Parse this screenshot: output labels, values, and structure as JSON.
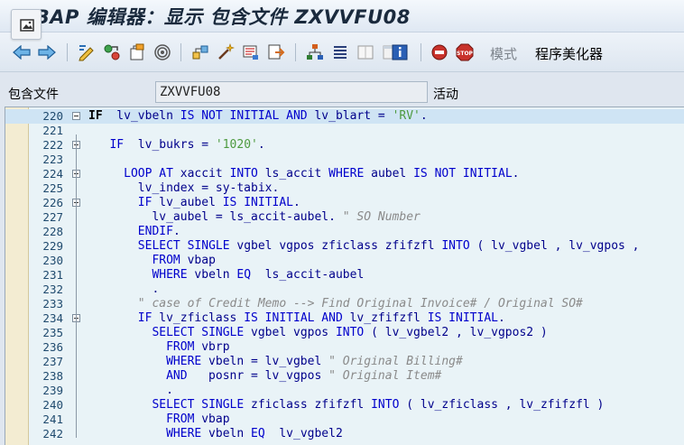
{
  "window": {
    "title": "ABAP 编辑器：显示 包含文件 ZXVVFU08"
  },
  "toolbar": {
    "mode_label": "模式",
    "pretty_printer_label": "程序美化器"
  },
  "include_field": {
    "label": "包含文件",
    "value": "ZXVVFU08",
    "status": "活动"
  },
  "editor": {
    "lines": [
      {
        "no": "220",
        "tokens": [
          [
            "b",
            "IF"
          ],
          [
            "",
            "  lv_vbeln "
          ],
          [
            "k",
            "IS NOT INITIAL AND"
          ],
          [
            "",
            " lv_blart = "
          ],
          [
            "s",
            "'RV'"
          ],
          [
            "",
            "."
          ]
        ]
      },
      {
        "no": "221",
        "tokens": []
      },
      {
        "no": "222",
        "tokens": [
          [
            "",
            "   "
          ],
          [
            "k",
            "IF"
          ],
          [
            "",
            "  lv_bukrs = "
          ],
          [
            "s",
            "'1020'"
          ],
          [
            "",
            "."
          ]
        ]
      },
      {
        "no": "223",
        "tokens": []
      },
      {
        "no": "224",
        "tokens": [
          [
            "",
            "     "
          ],
          [
            "k",
            "LOOP AT"
          ],
          [
            "",
            " xaccit "
          ],
          [
            "k",
            "INTO"
          ],
          [
            "",
            " ls_accit "
          ],
          [
            "k",
            "WHERE"
          ],
          [
            "",
            " aubel "
          ],
          [
            "k",
            "IS NOT INITIAL"
          ],
          [
            "",
            "."
          ]
        ]
      },
      {
        "no": "225",
        "tokens": [
          [
            "",
            "       lv_index = sy-tabix."
          ]
        ]
      },
      {
        "no": "226",
        "tokens": [
          [
            "",
            "       "
          ],
          [
            "k",
            "IF"
          ],
          [
            "",
            " lv_aubel "
          ],
          [
            "k",
            "IS INITIAL"
          ],
          [
            "",
            "."
          ]
        ]
      },
      {
        "no": "227",
        "tokens": [
          [
            "",
            "         lv_aubel = ls_accit-aubel. "
          ],
          [
            "c",
            "\" SO Number"
          ]
        ]
      },
      {
        "no": "228",
        "tokens": [
          [
            "",
            "       "
          ],
          [
            "k",
            "ENDIF"
          ],
          [
            "",
            "."
          ]
        ]
      },
      {
        "no": "229",
        "tokens": [
          [
            "",
            "       "
          ],
          [
            "k",
            "SELECT SINGLE"
          ],
          [
            "",
            " vgbel vgpos zficlass zfifzfl "
          ],
          [
            "k",
            "INTO"
          ],
          [
            "",
            " ( lv_vgbel , lv_vgpos ,"
          ]
        ]
      },
      {
        "no": "230",
        "tokens": [
          [
            "",
            "         "
          ],
          [
            "k",
            "FROM"
          ],
          [
            "",
            " vbap"
          ]
        ]
      },
      {
        "no": "231",
        "tokens": [
          [
            "",
            "         "
          ],
          [
            "k",
            "WHERE"
          ],
          [
            "",
            " vbeln "
          ],
          [
            "k",
            "EQ"
          ],
          [
            "",
            "  ls_accit-aubel"
          ]
        ]
      },
      {
        "no": "232",
        "tokens": [
          [
            "",
            "         ."
          ]
        ]
      },
      {
        "no": "233",
        "tokens": [
          [
            "",
            "       "
          ],
          [
            "c",
            "\" case of Credit Memo --> Find Original Invoice# / Original SO#"
          ]
        ]
      },
      {
        "no": "234",
        "tokens": [
          [
            "",
            "       "
          ],
          [
            "k",
            "IF"
          ],
          [
            "",
            " lv_zficlass "
          ],
          [
            "k",
            "IS INITIAL AND"
          ],
          [
            "",
            " lv_zfifzfl "
          ],
          [
            "k",
            "IS INITIAL"
          ],
          [
            "",
            "."
          ]
        ]
      },
      {
        "no": "235",
        "tokens": [
          [
            "",
            "         "
          ],
          [
            "k",
            "SELECT SINGLE"
          ],
          [
            "",
            " vgbel vgpos "
          ],
          [
            "k",
            "INTO"
          ],
          [
            "",
            " ( lv_vgbel2 , lv_vgpos2 )"
          ]
        ]
      },
      {
        "no": "236",
        "tokens": [
          [
            "",
            "           "
          ],
          [
            "k",
            "FROM"
          ],
          [
            "",
            " vbrp"
          ]
        ]
      },
      {
        "no": "237",
        "tokens": [
          [
            "",
            "           "
          ],
          [
            "k",
            "WHERE"
          ],
          [
            "",
            " vbeln = lv_vgbel "
          ],
          [
            "c",
            "\" Original Billing#"
          ]
        ]
      },
      {
        "no": "238",
        "tokens": [
          [
            "",
            "           "
          ],
          [
            "k",
            "AND"
          ],
          [
            "",
            "   posnr = lv_vgpos "
          ],
          [
            "c",
            "\" Original Item#"
          ]
        ]
      },
      {
        "no": "239",
        "tokens": [
          [
            "",
            "           ."
          ]
        ]
      },
      {
        "no": "240",
        "tokens": [
          [
            "",
            "         "
          ],
          [
            "k",
            "SELECT SINGLE"
          ],
          [
            "",
            " zficlass zfifzfl "
          ],
          [
            "k",
            "INTO"
          ],
          [
            "",
            " ( lv_zficlass , lv_zfifzfl )"
          ]
        ]
      },
      {
        "no": "241",
        "tokens": [
          [
            "",
            "           "
          ],
          [
            "k",
            "FROM"
          ],
          [
            "",
            " vbap"
          ]
        ]
      },
      {
        "no": "242",
        "tokens": [
          [
            "",
            "           "
          ],
          [
            "k",
            "WHERE"
          ],
          [
            "",
            " vbeln "
          ],
          [
            "k",
            "EQ"
          ],
          [
            "",
            "  lv_vgbel2"
          ]
        ]
      }
    ]
  }
}
